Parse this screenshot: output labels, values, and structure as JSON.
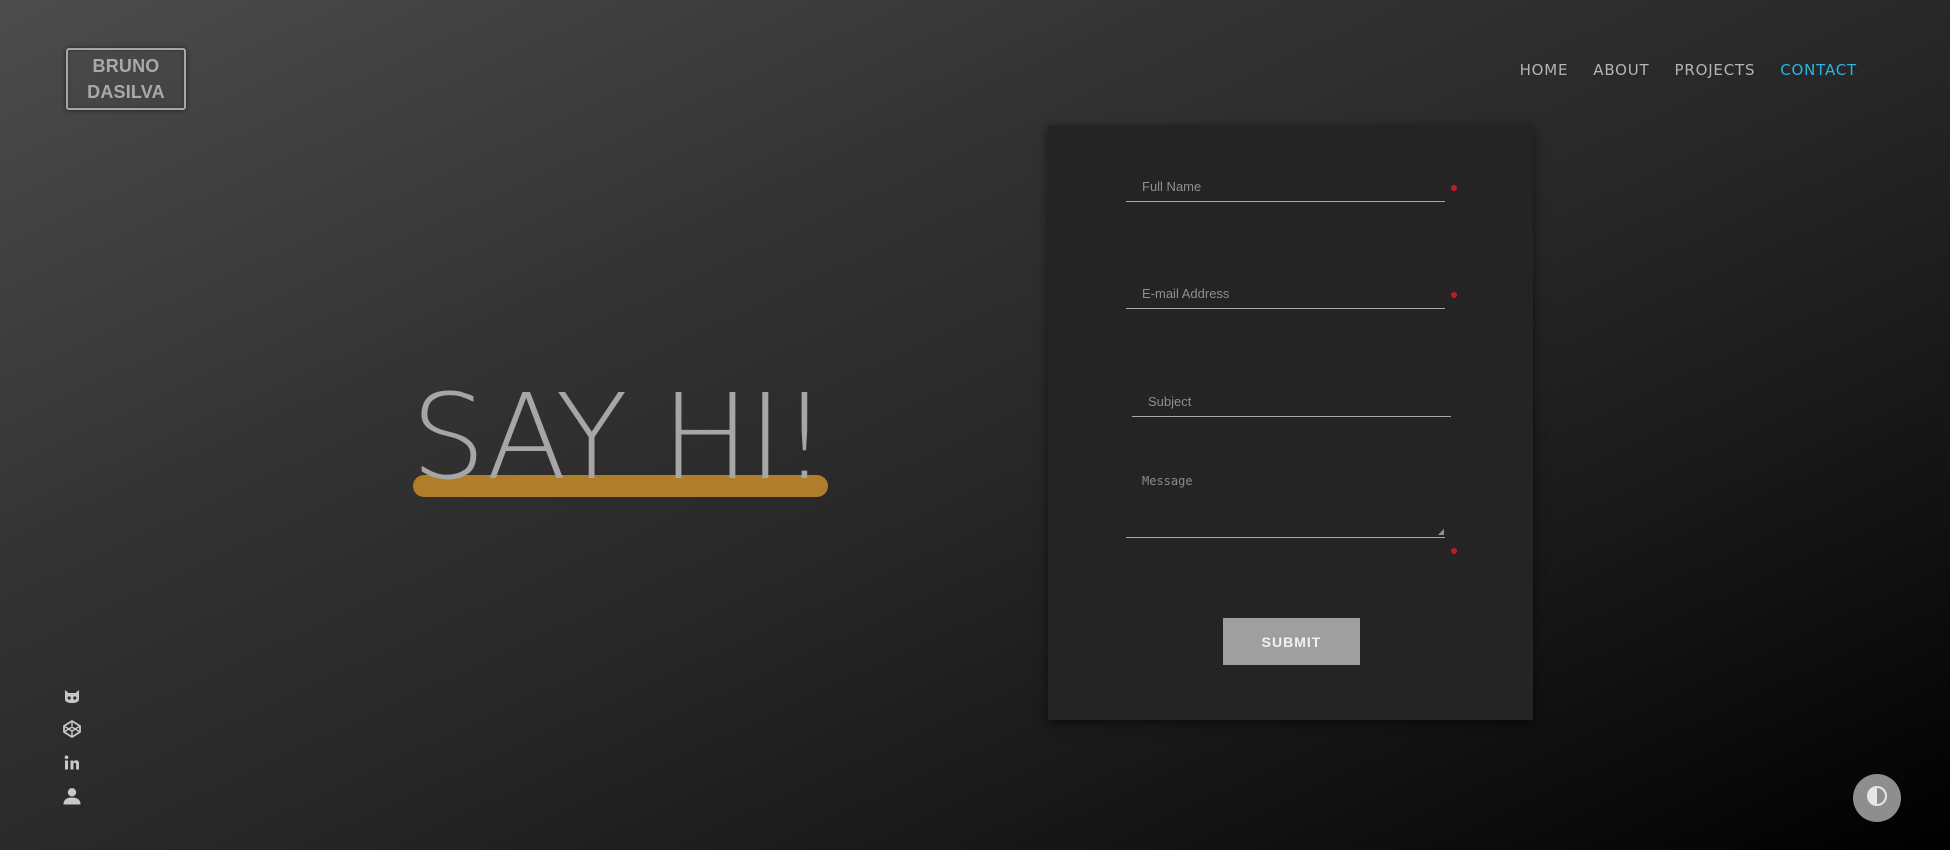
{
  "logo": {
    "line1": "BRUNO",
    "line2": "DASILVA"
  },
  "nav": {
    "items": [
      {
        "label": "HOME",
        "active": false
      },
      {
        "label": "ABOUT",
        "active": false
      },
      {
        "label": "PROJECTS",
        "active": false
      },
      {
        "label": "CONTACT",
        "active": true
      }
    ],
    "active_color": "#2eb3e6"
  },
  "hero": {
    "heading": "SAY HI!",
    "underline_color": "#b07d2a"
  },
  "form": {
    "full_name": {
      "placeholder": "Full Name",
      "value": "",
      "required": true
    },
    "email": {
      "placeholder": "E-mail Address",
      "value": "",
      "required": true
    },
    "subject": {
      "placeholder": "Subject",
      "value": "",
      "required": false
    },
    "message": {
      "placeholder": "Message",
      "value": "",
      "required": true
    },
    "required_color": "#c41b1b",
    "submit_label": "SUBMIT"
  },
  "socials": [
    {
      "icon": "github-icon"
    },
    {
      "icon": "codepen-icon"
    },
    {
      "icon": "linkedin-icon"
    },
    {
      "icon": "user-icon"
    }
  ],
  "theme_toggle": {
    "icon": "contrast-icon"
  }
}
